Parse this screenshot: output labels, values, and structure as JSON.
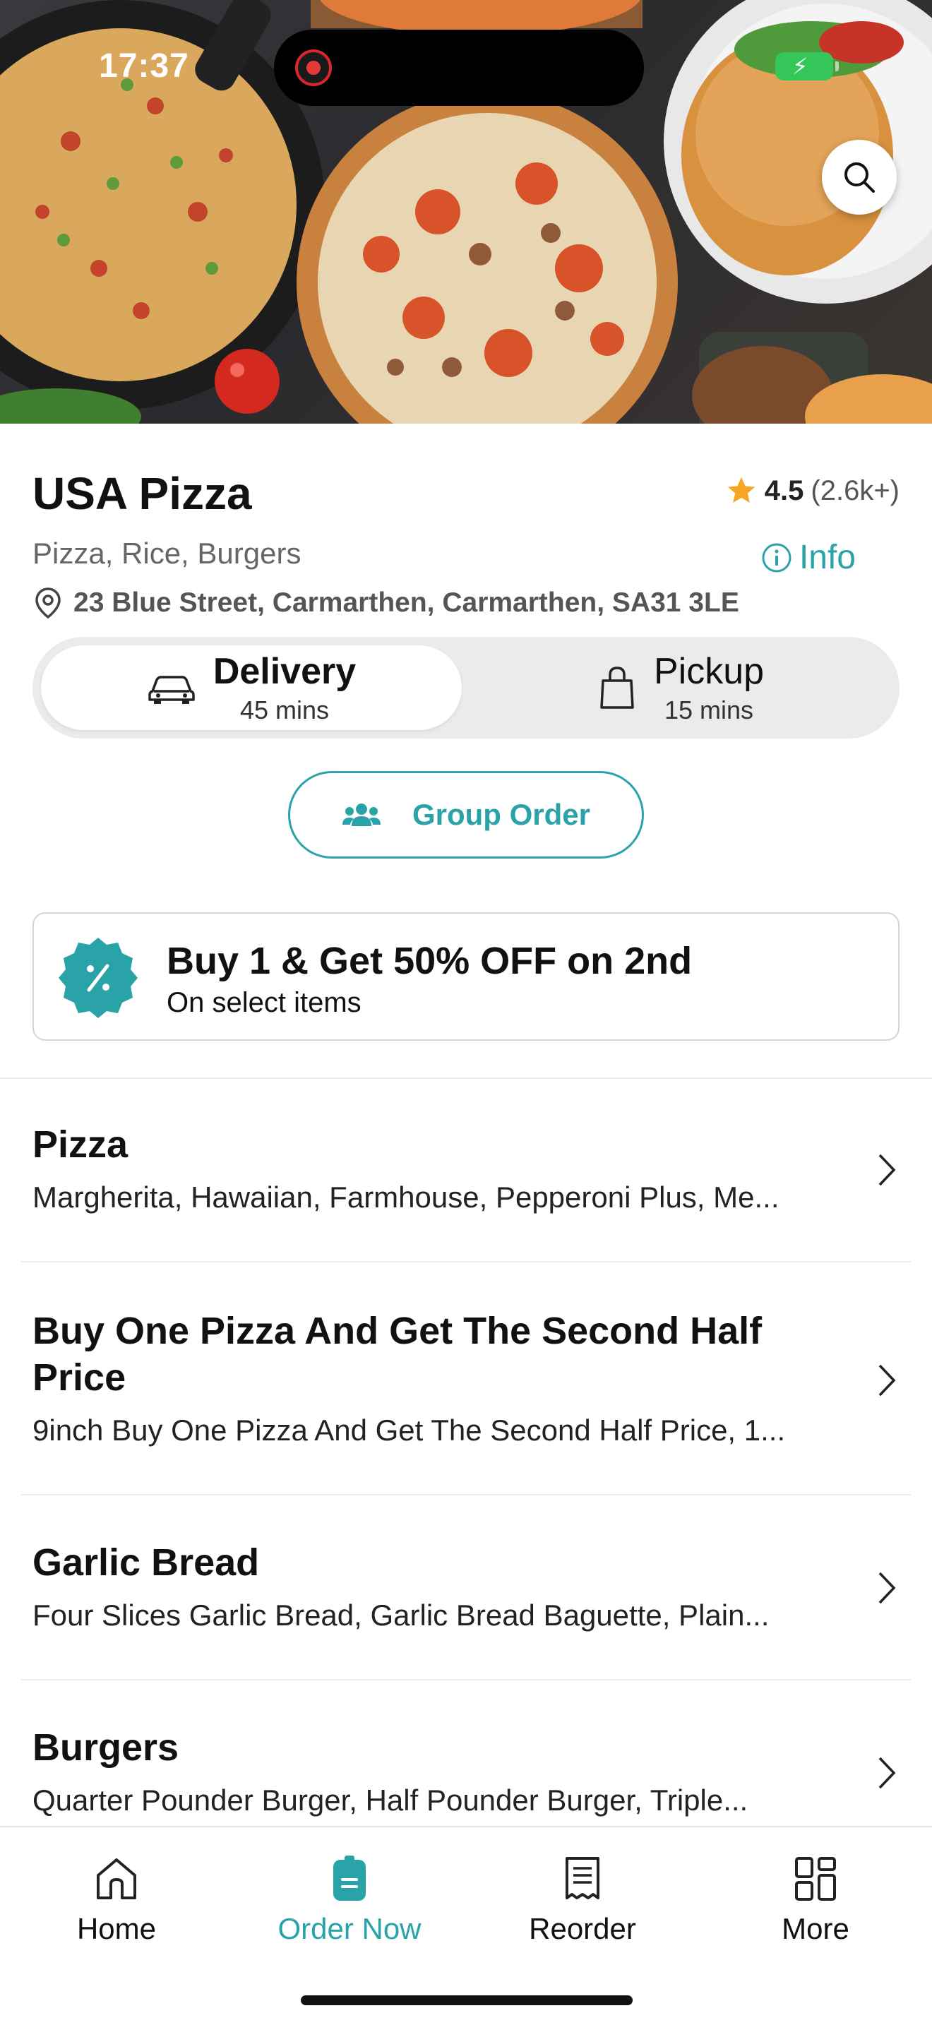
{
  "status_bar": {
    "time": "17:37"
  },
  "restaurant": {
    "name": "USA Pizza",
    "rating": "4.5",
    "rating_count": "(2.6k+)",
    "cuisines": "Pizza, Rice, Burgers",
    "info_label": "Info",
    "address": "23 Blue Street, Carmarthen, Carmarthen, SA31 3LE"
  },
  "fulfilment": {
    "delivery": {
      "label": "Delivery",
      "time": "45 mins"
    },
    "pickup": {
      "label": "Pickup",
      "time": "15 mins"
    }
  },
  "group_order": {
    "label": "Group Order"
  },
  "promo": {
    "title": "Buy 1 & Get 50% OFF on 2nd",
    "subtitle": "On select items"
  },
  "categories": [
    {
      "name": "Pizza",
      "items": "Margherita, Hawaiian, Farmhouse, Pepperoni Plus, Me..."
    },
    {
      "name": "Buy One Pizza And Get The Second Half Price",
      "items": "9inch Buy One Pizza And Get The Second Half Price, 1..."
    },
    {
      "name": "Garlic Bread",
      "items": "Four Slices Garlic Bread, Garlic Bread Baguette, Plain..."
    },
    {
      "name": "Burgers",
      "items": "Quarter Pounder Burger, Half Pounder Burger, Triple..."
    }
  ],
  "bottom_nav": [
    {
      "label": "Home",
      "icon": "home-icon"
    },
    {
      "label": "Order Now",
      "icon": "order-now-icon"
    },
    {
      "label": "Reorder",
      "icon": "receipt-icon"
    },
    {
      "label": "More",
      "icon": "grid-icon"
    }
  ],
  "colors": {
    "accent": "#2aa3a8",
    "star": "#f5a623"
  }
}
